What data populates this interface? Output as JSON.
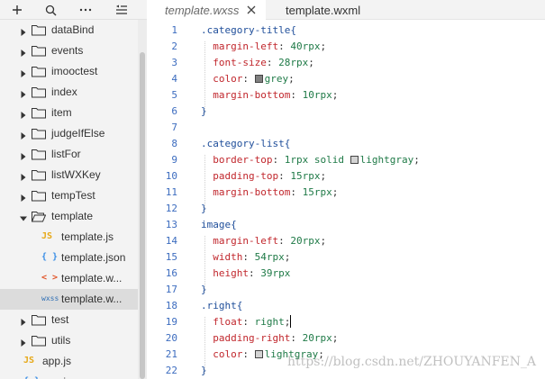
{
  "toolbar": {
    "icons": [
      "plus-icon",
      "search-icon",
      "ellipsis-icon",
      "collapse-icon"
    ]
  },
  "tree": {
    "items": [
      {
        "label": "dataBind",
        "type": "folder",
        "expanded": false
      },
      {
        "label": "events",
        "type": "folder",
        "expanded": false
      },
      {
        "label": "imooctest",
        "type": "folder",
        "expanded": false
      },
      {
        "label": "index",
        "type": "folder",
        "expanded": false
      },
      {
        "label": "item",
        "type": "folder",
        "expanded": false
      },
      {
        "label": "judgeIfElse",
        "type": "folder",
        "expanded": false
      },
      {
        "label": "listFor",
        "type": "folder",
        "expanded": false
      },
      {
        "label": "listWXKey",
        "type": "folder",
        "expanded": false
      },
      {
        "label": "tempTest",
        "type": "folder",
        "expanded": false
      },
      {
        "label": "template",
        "type": "folder",
        "expanded": true
      },
      {
        "label": "template.js",
        "type": "file",
        "badge": "JS"
      },
      {
        "label": "template.json",
        "type": "file",
        "badge": "{ }"
      },
      {
        "label": "template.w...",
        "type": "file",
        "badge": "< >"
      },
      {
        "label": "template.w...",
        "type": "file",
        "badge": "wxss",
        "selected": true
      },
      {
        "label": "test",
        "type": "folder",
        "expanded": false
      },
      {
        "label": "utils",
        "type": "folder",
        "expanded": false
      },
      {
        "label": "app.js",
        "type": "file",
        "badge": "JS"
      },
      {
        "label": "app.json",
        "type": "file",
        "badge": "{ }"
      }
    ]
  },
  "tabs": [
    {
      "label": "template.wxss",
      "active": true
    },
    {
      "label": "template.wxml",
      "active": false
    }
  ],
  "colors": {
    "selector": "#1f4e9a",
    "property": "#c1272d",
    "value": "#1f7a47",
    "line_number": "#3c6cbf",
    "grey_swatch": "#808080",
    "lightgray_swatch": "#d3d3d3"
  },
  "code": {
    "lines": [
      {
        "n": "1",
        "sel": ".category-title{"
      },
      {
        "n": "2",
        "prop": "margin-left",
        "val": "40rpx"
      },
      {
        "n": "3",
        "prop": "font-size",
        "val": "28rpx"
      },
      {
        "n": "4",
        "prop": "color",
        "val": "grey",
        "swatch": "grey"
      },
      {
        "n": "5",
        "prop": "margin-bottom",
        "val": "10rpx"
      },
      {
        "n": "6",
        "sel": "}"
      },
      {
        "n": "7"
      },
      {
        "n": "8",
        "sel": ".category-list{"
      },
      {
        "n": "9",
        "prop": "border-top",
        "val": "1rpx solid ",
        "swatch": "lightgray",
        "val2": "lightgray"
      },
      {
        "n": "10",
        "prop": "padding-top",
        "val": "15rpx"
      },
      {
        "n": "11",
        "prop": "margin-bottom",
        "val": "15rpx"
      },
      {
        "n": "12",
        "sel": "}"
      },
      {
        "n": "13",
        "sel": "image{"
      },
      {
        "n": "14",
        "prop": "margin-left",
        "val": "20rpx"
      },
      {
        "n": "15",
        "prop": "width",
        "val": "54rpx"
      },
      {
        "n": "16",
        "prop": "height",
        "val": "39rpx",
        "nosemi": true
      },
      {
        "n": "17",
        "sel": "}"
      },
      {
        "n": "18",
        "sel": ".right{"
      },
      {
        "n": "19",
        "prop": "float",
        "val": "right",
        "cursor": true
      },
      {
        "n": "20",
        "prop": "padding-right",
        "val": "20rpx"
      },
      {
        "n": "21",
        "prop": "color",
        "val": "lightgray",
        "swatch": "lightgray"
      },
      {
        "n": "22",
        "sel": "}"
      }
    ]
  },
  "watermark": "https://blog.csdn.net/ZHOUYANFEN_A"
}
